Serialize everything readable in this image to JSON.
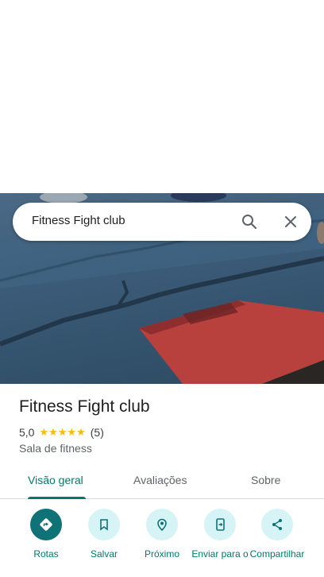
{
  "search": {
    "query": "Fitness Fight club"
  },
  "place": {
    "name": "Fitness Fight club",
    "rating": "5,0",
    "stars": "★★★★★",
    "reviews": "(5)",
    "category": "Sala de fitness"
  },
  "tabs": [
    "Visão geral",
    "Avaliações",
    "Sobre"
  ],
  "actions": [
    {
      "label": "Rotas",
      "icon": "directions-icon"
    },
    {
      "label": "Salvar",
      "icon": "bookmark-icon"
    },
    {
      "label": "Próximo",
      "icon": "nearby-icon"
    },
    {
      "label": "Enviar para o",
      "icon": "send-to-phone-icon"
    },
    {
      "label": "Compartilhar",
      "icon": "share-icon"
    }
  ],
  "colors": {
    "accent": "#00796b",
    "star": "#fbbc04",
    "chip": "#d6f4f5",
    "primary": "#0f7276"
  }
}
